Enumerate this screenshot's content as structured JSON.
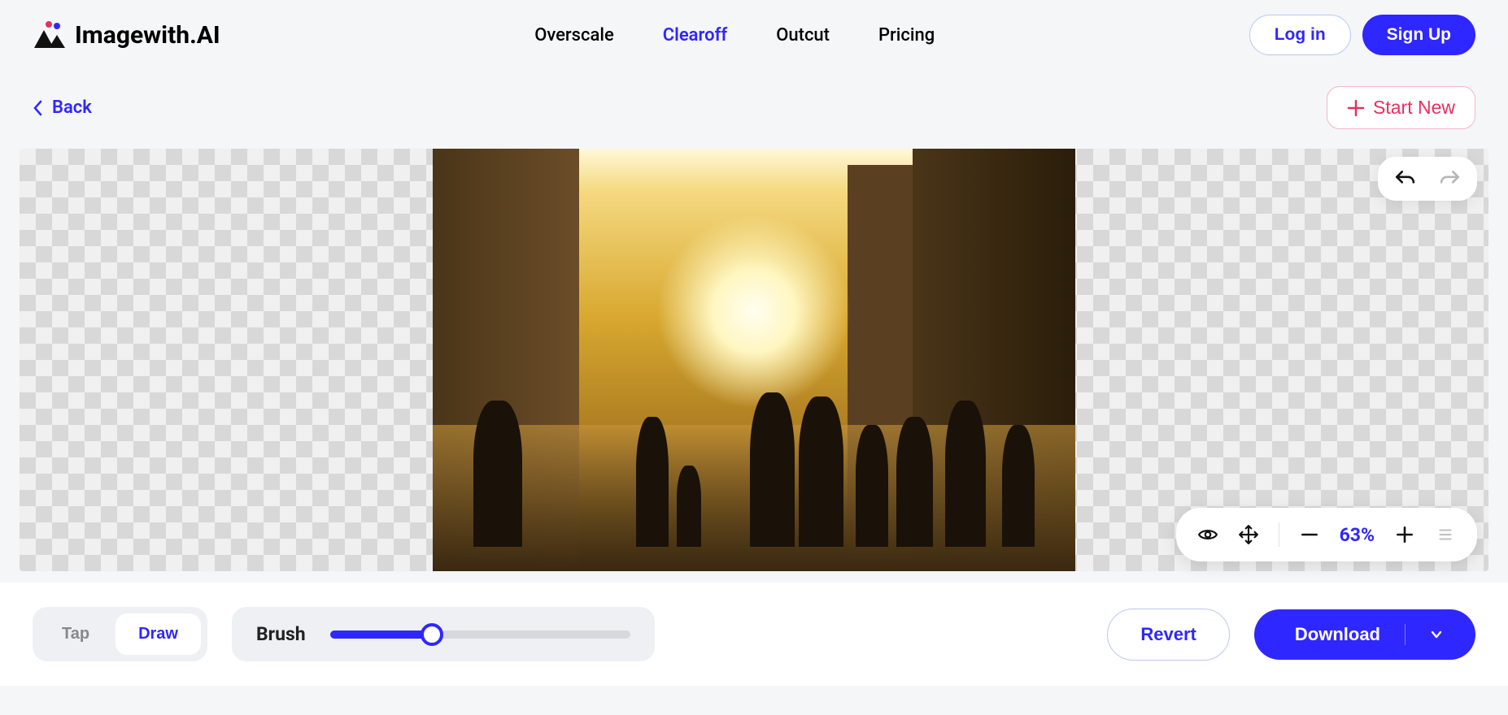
{
  "brand": "Imagewith.AI",
  "nav": {
    "items": [
      "Overscale",
      "Clearoff",
      "Outcut",
      "Pricing"
    ],
    "active_index": 1,
    "login": "Log in",
    "signup": "Sign Up"
  },
  "subbar": {
    "back": "Back",
    "start_new": "Start New"
  },
  "zoom": {
    "value": "63%"
  },
  "toolbar": {
    "tap": "Tap",
    "draw": "Draw",
    "brush_label": "Brush",
    "brush_percent": 34,
    "revert": "Revert",
    "download": "Download"
  },
  "colors": {
    "primary": "#2F27FF",
    "accent_red": "#e6305f"
  }
}
